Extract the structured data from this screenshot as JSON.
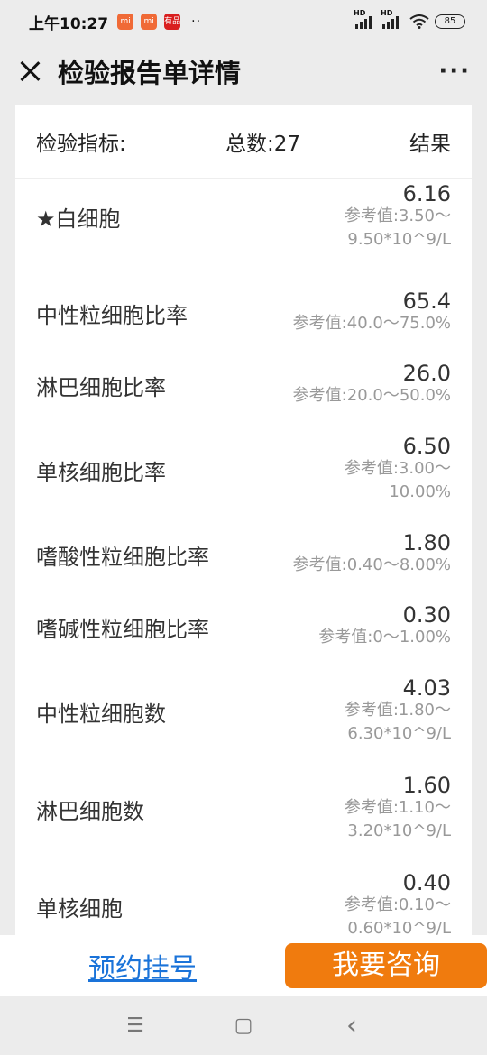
{
  "status": {
    "time": "上午10:27",
    "notif_icons": [
      "mi",
      "mi",
      "有品"
    ],
    "more": "··",
    "hd1": "HD",
    "hd2": "HD",
    "battery": "85"
  },
  "nav": {
    "title": "检验报告单详情",
    "menu": "···"
  },
  "table_header": {
    "indicator": "检验指标:",
    "total": "总数:27",
    "result": "结果"
  },
  "rows": [
    {
      "name": "★白细胞",
      "value": "6.16",
      "ref1": "参考值:3.50～",
      "ref2": "9.50*10^9/L"
    },
    {
      "name": "中性粒细胞比率",
      "value": "65.4",
      "ref1": "参考值:40.0～75.0%",
      "ref2": ""
    },
    {
      "name": "淋巴细胞比率",
      "value": "26.0",
      "ref1": "参考值:20.0～50.0%",
      "ref2": ""
    },
    {
      "name": "单核细胞比率",
      "value": "6.50",
      "ref1": "参考值:3.00～",
      "ref2": "10.00%"
    },
    {
      "name": "嗜酸性粒细胞比率",
      "value": "1.80",
      "ref1": "参考值:0.40～8.00%",
      "ref2": ""
    },
    {
      "name": "嗜碱性粒细胞比率",
      "value": "0.30",
      "ref1": "参考值:0～1.00%",
      "ref2": ""
    },
    {
      "name": "中性粒细胞数",
      "value": "4.03",
      "ref1": "参考值:1.80～",
      "ref2": "6.30*10^9/L"
    },
    {
      "name": "淋巴细胞数",
      "value": "1.60",
      "ref1": "参考值:1.10～",
      "ref2": "3.20*10^9/L"
    },
    {
      "name": "单核细胞",
      "value": "0.40",
      "ref1": "参考值:0.10～",
      "ref2": "0.60*10^9/L"
    }
  ],
  "bottom": {
    "appointment": "预约挂号",
    "consult": "我要咨询"
  },
  "system_nav": {
    "menu_icon": "☰",
    "home_icon": "▢",
    "back_icon": "‹"
  }
}
